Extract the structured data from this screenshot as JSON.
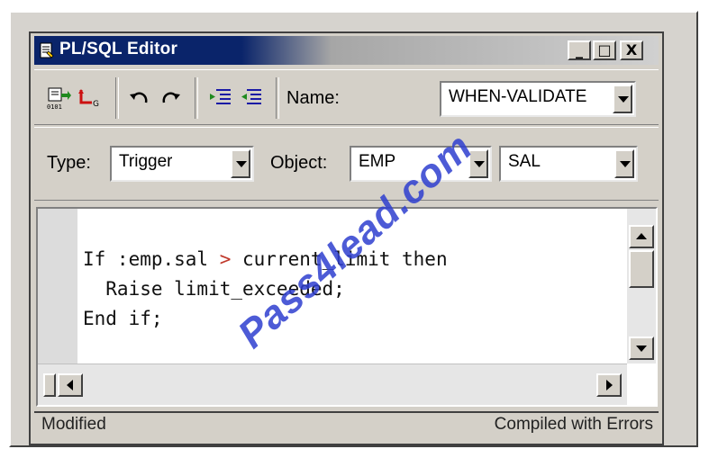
{
  "window": {
    "title": "PL/SQL Editor",
    "controls": {
      "minimize": "_",
      "maximize": "□",
      "close": "X"
    }
  },
  "toolbar": {
    "icons": [
      "compile-icon",
      "revert-icon",
      "undo-icon",
      "redo-icon",
      "indent-icon",
      "outdent-icon"
    ],
    "name_label": "Name:",
    "name_value": "WHEN-VALIDATE"
  },
  "object_bar": {
    "type_label": "Type:",
    "type_value": "Trigger",
    "object_label": "Object:",
    "object_value": "EMP",
    "item_value": "SAL"
  },
  "code": {
    "line1_a": "If :emp.sal ",
    "line1_op": ">",
    "line1_b": " current_limit then",
    "line2": "  Raise limit_exceeded;",
    "line3": "End if;"
  },
  "status": {
    "left": "Modified",
    "right": "Compiled with Errors"
  },
  "watermark": "Pass4lead.com",
  "colors": {
    "title_bar": "#0a246a",
    "window_face": "#d4d0c8",
    "watermark": "#2f3fd0",
    "operator": "#c0392b"
  }
}
